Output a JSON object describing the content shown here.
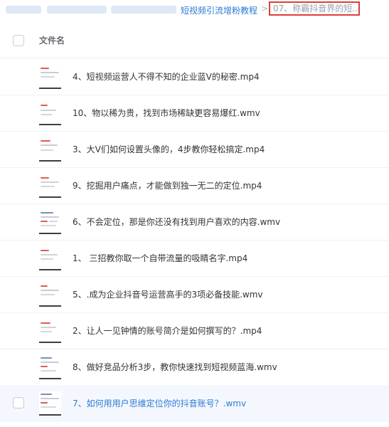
{
  "breadcrumb": {
    "parent": "短视频引流增粉教程",
    "separator": ">",
    "current": "07、称霸抖音界的短..."
  },
  "header": {
    "column_label": "文件名"
  },
  "files": [
    {
      "name": "4、短视频运营人不得不知的企业蓝V的秘密.mp4"
    },
    {
      "name": "10、物以稀为贵，找到市场稀缺更容易爆红.wmv"
    },
    {
      "name": "3、大V们如何设置头像的，4步教你轻松搞定.mp4"
    },
    {
      "name": "9、挖掘用户痛点，才能做到独一无二的定位.mp4"
    },
    {
      "name": "6、不会定位，那是你还没有找到用户喜欢的内容.wmv"
    },
    {
      "name": "1、 三招教你取一个自带流量的吸睛名字.mp4"
    },
    {
      "name": "5、.成为企业抖音号运营高手的3项必备技能.wmv"
    },
    {
      "name": "2、让人一见钟情的账号简介是如何撰写的？.mp4"
    },
    {
      "name": "8、做好竞品分析3步，教你快速找到短视频蓝海.wmv"
    },
    {
      "name": "7、如何用用户思维定位你的抖音账号？.wmv"
    }
  ],
  "colors": {
    "link": "#2e7ad6",
    "highlight_border": "#d9403a",
    "selected_row": "#f4f8fe"
  }
}
